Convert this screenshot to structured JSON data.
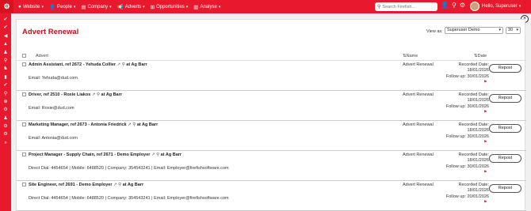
{
  "topbar": {
    "logo_icon": "⚙",
    "nav": [
      {
        "icon": "●",
        "label": "Website"
      },
      {
        "icon": "👤",
        "label": "People"
      },
      {
        "icon": "▤",
        "label": "Company"
      },
      {
        "icon": "📢",
        "label": "Adverts"
      },
      {
        "icon": "⊞",
        "label": "Opportunities"
      },
      {
        "icon": "▥",
        "label": "Analyse"
      }
    ],
    "search_placeholder": "Search Firefish...",
    "user_greeting": "Hello, Superuser",
    "brand_color": "#e8192c"
  },
  "sidebar_icons": [
    "✔",
    "✔",
    "◀",
    "▲",
    "♟",
    "⚲",
    "♞",
    "▮",
    "✔",
    "⚲",
    "⊕",
    "⚙",
    "♟",
    "⚙",
    "⚙",
    "»"
  ],
  "panel": {
    "title": "Advert Renewal",
    "view_as_label": "View as:",
    "view_as_value": "Superuser Demo",
    "page_size": "30",
    "columns": {
      "advert": "Advert",
      "name": "Name",
      "date": "Date"
    }
  },
  "rows": [
    {
      "title": "Admin Assistant, ref 2672 -",
      "contact": "Yehuda Collier",
      "company": "at Ag Barr",
      "detail": "Email: Yehuda@dud.com",
      "type": "Advert Renewal",
      "recorded_label": "Recorded Date:",
      "recorded_date": "18/01/2026",
      "follow_label": "Follow up:",
      "follow_date": "30/01/2026",
      "action": "Repost"
    },
    {
      "title": "Driver, ref 2510 -",
      "contact": "Roxie Liakos",
      "company": "at Ag Barr",
      "detail": "Email: Roxie@dud.com",
      "type": "Advert Renewal",
      "recorded_label": "Recorded Date:",
      "recorded_date": "18/01/2026",
      "follow_label": "Follow up:",
      "follow_date": "30/01/2026",
      "action": "Repost"
    },
    {
      "title": "Marketing Manager, ref 2673 -",
      "contact": "Antonia Friedrick",
      "company": "at Ag Barr",
      "detail": "Email: Antonia@dud.com",
      "type": "Advert Renewal",
      "recorded_label": "Recorded Date:",
      "recorded_date": "18/01/2026",
      "follow_label": "Follow up:",
      "follow_date": "30/01/2026",
      "action": "Repost"
    },
    {
      "title": "Project Manager - Supply Chain, ref 2671 -",
      "contact": "Demo Employer",
      "company": "at Ag Barr",
      "detail": "Direct Dial: 4454654 | Mobile: 6488520 | Company: 354543241 | Email: Employer@firefishsoftware.com",
      "type": "Advert Renewal",
      "recorded_label": "Recorded Date:",
      "recorded_date": "18/01/2026",
      "follow_label": "Follow up:",
      "follow_date": "30/01/2026",
      "action": "Repost"
    },
    {
      "title": "Site Engineer, ref 2691 -",
      "contact": "Demo Employer",
      "company": "at Ag Barr",
      "detail": "Direct Dial: 4454654 | Mobile: 6488520 | Company: 354543241 | Email: Employer@firefishsoftware.com",
      "type": "Advert Renewal",
      "recorded_label": "Recorded Date:",
      "recorded_date": "18/01/2026",
      "follow_label": "Follow up:",
      "follow_date": "20/01/2026",
      "action": "Repost"
    }
  ]
}
